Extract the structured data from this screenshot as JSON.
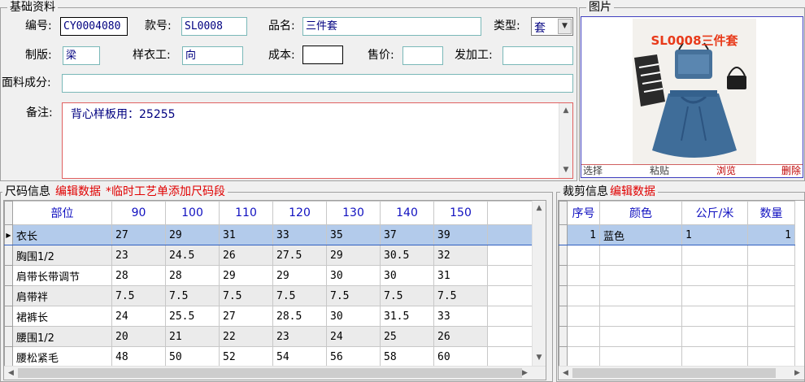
{
  "basic": {
    "title": "基础资料",
    "code_label": "编号:",
    "code_value": "CY0004080",
    "style_label": "款号:",
    "style_value": "SL0008",
    "name_label": "品名:",
    "name_value": "三件套",
    "type_label": "类型:",
    "type_value": "套",
    "pattern_label": "制版:",
    "pattern_value": "梁",
    "sample_label": "样衣工:",
    "sample_value": "向",
    "cost_label": "成本:",
    "cost_value": "",
    "price_label": "售价:",
    "price_value": "",
    "outsource_label": "发加工:",
    "outsource_value": "",
    "fabric_label": "面料成分:",
    "fabric_value": "",
    "remark_label": "备注:",
    "remark_value": "背心样板用：25255"
  },
  "picture": {
    "title": "图片",
    "caption": "SL0008三件套",
    "actions": [
      "选择",
      "粘贴",
      "浏览",
      "删除"
    ],
    "accent": "#e83a1a"
  },
  "size": {
    "title": "尺码信息",
    "edit": "编辑数据",
    "note": "*临时工艺单添加尺码段",
    "headers": [
      "部位",
      "90",
      "100",
      "110",
      "120",
      "130",
      "140",
      "150"
    ],
    "rows": [
      [
        "衣长",
        "27",
        "29",
        "31",
        "33",
        "35",
        "37",
        "39"
      ],
      [
        "胸围1/2",
        "23",
        "24.5",
        "26",
        "27.5",
        "29",
        "30.5",
        "32"
      ],
      [
        "肩带长带调节",
        "28",
        "28",
        "29",
        "29",
        "30",
        "30",
        "31"
      ],
      [
        "肩带袢",
        "7.5",
        "7.5",
        "7.5",
        "7.5",
        "7.5",
        "7.5",
        "7.5"
      ],
      [
        "裙裤长",
        "24",
        "25.5",
        "27",
        "28.5",
        "30",
        "31.5",
        "33"
      ],
      [
        "腰围1/2",
        "20",
        "21",
        "22",
        "23",
        "24",
        "25",
        "26"
      ],
      [
        "腰松紧毛",
        "48",
        "50",
        "52",
        "54",
        "56",
        "58",
        "60"
      ]
    ]
  },
  "cut": {
    "title": "裁剪信息",
    "edit": "编辑数据",
    "headers": [
      "序号",
      "颜色",
      "公斤/米",
      "数量"
    ],
    "rows": [
      [
        "1",
        "蓝色",
        "1",
        "1"
      ]
    ]
  }
}
